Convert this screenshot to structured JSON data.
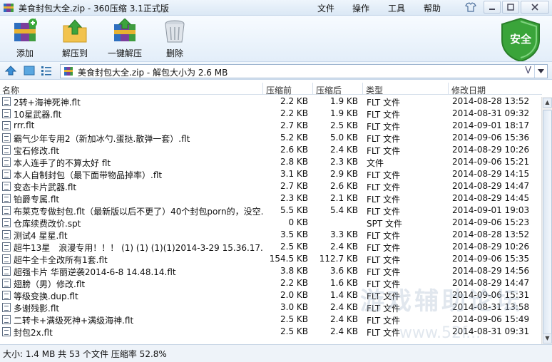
{
  "window": {
    "title": "美食封包大全.zip - 360压缩 3.1正式版",
    "menu": [
      "文件",
      "操作",
      "工具",
      "帮助"
    ]
  },
  "toolbar": {
    "add": "添加",
    "extract_to": "解压到",
    "one_click": "一键解压",
    "delete": "删除",
    "safe_badge": "安全"
  },
  "address": {
    "text": "美食封包大全.zip - 解包大小为 2.6 MB",
    "v_glyph": "V"
  },
  "columns": {
    "name": "名称",
    "before": "压缩前",
    "after": "压缩后",
    "type": "类型",
    "date": "修改日期"
  },
  "files": [
    {
      "name": "2转+海神死神.flt",
      "before": "2.2 KB",
      "after": "1.9 KB",
      "type": "FLT 文件",
      "date": "2014-08-28 13:52"
    },
    {
      "name": "10星武器.flt",
      "before": "2.2 KB",
      "after": "1.9 KB",
      "type": "FLT 文件",
      "date": "2014-08-31 09:32"
    },
    {
      "name": "rrr.flt",
      "before": "2.7 KB",
      "after": "2.5 KB",
      "type": "FLT 文件",
      "date": "2014-09-01 18:17"
    },
    {
      "name": "霸气少年专用2（新加冰勺.蛋挞.散弹一套）.flt",
      "before": "5.2 KB",
      "after": "5.0 KB",
      "type": "FLT 文件",
      "date": "2014-09-06 15:36"
    },
    {
      "name": "宝石修改.flt",
      "before": "2.6 KB",
      "after": "2.4 KB",
      "type": "FLT 文件",
      "date": "2014-08-29 10:26"
    },
    {
      "name": "本人连手了的不算太好 flt",
      "before": "2.8 KB",
      "after": "2.3 KB",
      "type": "文件",
      "date": "2014-09-06 15:21"
    },
    {
      "name": "本人自制封包（最下面带物品掉率）.flt",
      "before": "3.1 KB",
      "after": "2.9 KB",
      "type": "FLT 文件",
      "date": "2014-08-29 14:15"
    },
    {
      "name": "变态卡片武器.flt",
      "before": "2.7 KB",
      "after": "2.6 KB",
      "type": "FLT 文件",
      "date": "2014-08-29 14:47"
    },
    {
      "name": "铂爵专属.flt",
      "before": "2.3 KB",
      "after": "2.1 KB",
      "type": "FLT 文件",
      "date": "2014-08-29 14:45"
    },
    {
      "name": "布莱克专做封包.flt（最新版以后不更了）40个封包porn的，没空...",
      "before": "5.5 KB",
      "after": "5.4 KB",
      "type": "FLT 文件",
      "date": "2014-09-01 19:03"
    },
    {
      "name": "仓库续费改价.spt",
      "before": "0 KB",
      "after": "",
      "type": "SPT 文件",
      "date": "2014-09-06 15:23"
    },
    {
      "name": "测试4 星星.flt",
      "before": "3.5 KB",
      "after": "3.3 KB",
      "type": "FLT 文件",
      "date": "2014-08-28 13:52"
    },
    {
      "name": "超牛13星　浪漫专用！！！ (1) (1) (1)(1)2014-3-29 15.36.17...",
      "before": "2.5 KB",
      "after": "2.4 KB",
      "type": "FLT 文件",
      "date": "2014-08-29 10:26"
    },
    {
      "name": "超牛全卡全改所有1套.flt",
      "before": "154.5 KB",
      "after": "112.7 KB",
      "type": "FLT 文件",
      "date": "2014-09-06 15:35"
    },
    {
      "name": "超强卡片 华丽逆袭2014-6-8 14.48.14.flt",
      "before": "3.8 KB",
      "after": "3.6 KB",
      "type": "FLT 文件",
      "date": "2014-08-29 14:56"
    },
    {
      "name": "翅膀（男）修改.flt",
      "before": "2.2 KB",
      "after": "1.6 KB",
      "type": "FLT 文件",
      "date": "2014-08-29 14:47"
    },
    {
      "name": "等级变换.dup.flt",
      "before": "2.0 KB",
      "after": "1.4 KB",
      "type": "FLT 文件",
      "date": "2014-09-06 15:31"
    },
    {
      "name": "多谢残影.flt",
      "before": "3.0 KB",
      "after": "2.4 KB",
      "type": "FLT 文件",
      "date": "2014-08-31 13:58"
    },
    {
      "name": "二转卡+满级死神+满级海神.flt",
      "before": "2.5 KB",
      "after": "2.4 KB",
      "type": "FLT 文件",
      "date": "2014-09-06 15:49"
    },
    {
      "name": "封包2x.flt",
      "before": "2.5 KB",
      "after": "2.4 KB",
      "type": "FLT 文件",
      "date": "2014-08-31 09:31"
    }
  ],
  "status": {
    "text": "大小: 1.4 MB 共 53 个文件 压缩率 52.8%"
  },
  "watermark": {
    "line1": "游戏辅助论坛",
    "line2": "www.52f..."
  },
  "colors": {
    "safe_green": "#3aa43a",
    "titlebar_bg": "#dbe8f5"
  }
}
